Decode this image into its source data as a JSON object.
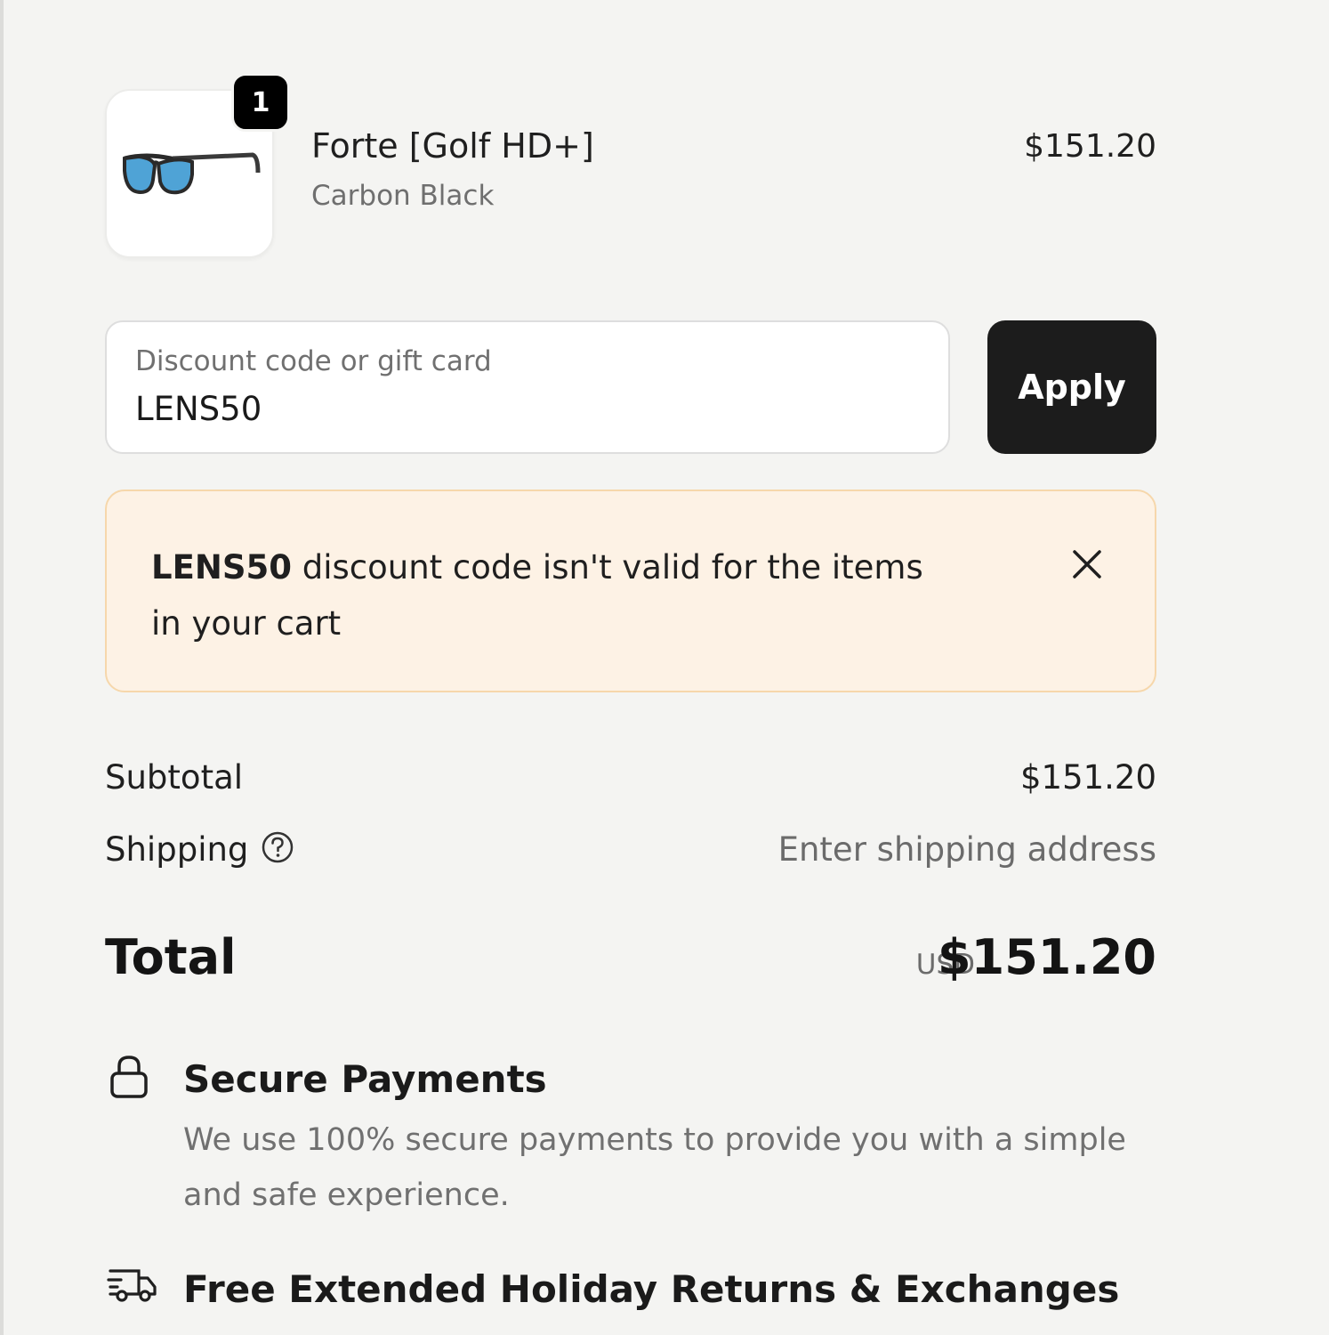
{
  "line_item": {
    "quantity": "1",
    "name": "Forte [Golf HD+]",
    "variant": "Carbon Black",
    "price": "$151.20",
    "image_icon": "sunglasses-product-image"
  },
  "discount": {
    "label": "Discount code or gift card",
    "value": "LENS50",
    "apply_label": "Apply"
  },
  "warning": {
    "code": "LENS50",
    "message": " discount code isn't valid for the items in your cart",
    "close_icon": "close-icon"
  },
  "summary": {
    "subtotal_label": "Subtotal",
    "subtotal_value": "$151.20",
    "shipping_label": "Shipping",
    "shipping_value": "Enter shipping address",
    "total_label": "Total",
    "total_currency": "USD",
    "total_value": "$151.20"
  },
  "features": {
    "secure_title": "Secure Payments",
    "secure_desc": "We use 100% secure payments to provide you with a simple and safe experience.",
    "returns_title": "Free Extended Holiday Returns & Exchanges"
  },
  "colors": {
    "background": "#f4f4f2",
    "button": "#1c1c1c",
    "warning_bg": "#fdf2e5",
    "warning_border": "#f6d7ab"
  }
}
